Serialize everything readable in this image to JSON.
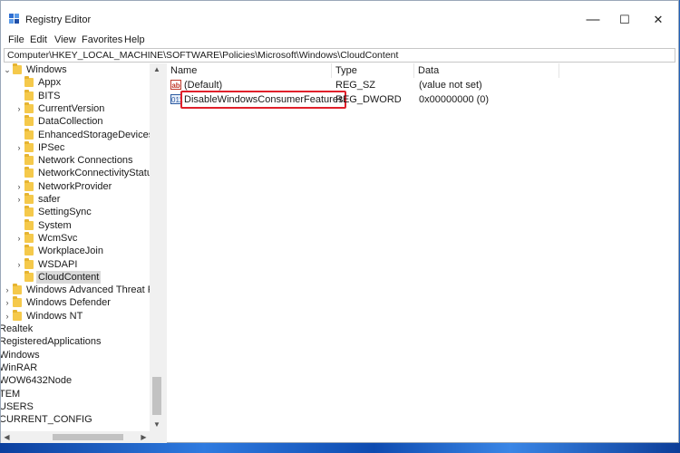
{
  "window": {
    "title": "Registry Editor",
    "icon": "registry-editor-icon",
    "controls": {
      "minimize": "—",
      "maximize": "☐",
      "close": "✕"
    }
  },
  "menu": [
    "File",
    "Edit",
    "View",
    "Favorites",
    "Help"
  ],
  "address": "Computer\\HKEY_LOCAL_MACHINE\\SOFTWARE\\Policies\\Microsoft\\Windows\\CloudContent",
  "tree": {
    "items": [
      {
        "label": "Windows",
        "level": 1,
        "expander": "expanded"
      },
      {
        "label": "Appx",
        "level": 2,
        "expander": "none"
      },
      {
        "label": "BITS",
        "level": 2,
        "expander": "none"
      },
      {
        "label": "CurrentVersion",
        "level": 2,
        "expander": "collapsed"
      },
      {
        "label": "DataCollection",
        "level": 2,
        "expander": "none"
      },
      {
        "label": "EnhancedStorageDevices",
        "level": 2,
        "expander": "none"
      },
      {
        "label": "IPSec",
        "level": 2,
        "expander": "collapsed"
      },
      {
        "label": "Network Connections",
        "level": 2,
        "expander": "none"
      },
      {
        "label": "NetworkConnectivityStatusIn",
        "level": 2,
        "expander": "none"
      },
      {
        "label": "NetworkProvider",
        "level": 2,
        "expander": "collapsed"
      },
      {
        "label": "safer",
        "level": 2,
        "expander": "collapsed"
      },
      {
        "label": "SettingSync",
        "level": 2,
        "expander": "none"
      },
      {
        "label": "System",
        "level": 2,
        "expander": "none"
      },
      {
        "label": "WcmSvc",
        "level": 2,
        "expander": "collapsed"
      },
      {
        "label": "WorkplaceJoin",
        "level": 2,
        "expander": "none"
      },
      {
        "label": "WSDAPI",
        "level": 2,
        "expander": "collapsed"
      },
      {
        "label": "CloudContent",
        "level": 2,
        "expander": "none",
        "selected": true
      },
      {
        "label": "Windows Advanced Threat Prote",
        "level": 1,
        "expander": "collapsed"
      },
      {
        "label": "Windows Defender",
        "level": 1,
        "expander": "collapsed"
      },
      {
        "label": "Windows NT",
        "level": 1,
        "expander": "collapsed"
      },
      {
        "label": "Realtek",
        "level": 0,
        "expander": "none"
      },
      {
        "label": "RegisteredApplications",
        "level": 0,
        "expander": "none"
      },
      {
        "label": "Windows",
        "level": 0,
        "expander": "none"
      },
      {
        "label": "WinRAR",
        "level": 0,
        "expander": "none"
      },
      {
        "label": "WOW6432Node",
        "level": 0,
        "expander": "none"
      },
      {
        "label": "TEM",
        "level": 0,
        "expander": "none"
      },
      {
        "label": "USERS",
        "level": 0,
        "expander": "none"
      },
      {
        "label": "CURRENT_CONFIG",
        "level": 0,
        "expander": "none"
      }
    ]
  },
  "values_pane": {
    "columns": [
      "Name",
      "Type",
      "Data"
    ],
    "rows": [
      {
        "name": "(Default)",
        "type": "REG_SZ",
        "data": "(value not set)",
        "icon": "ab",
        "icon_name": "string-value-icon",
        "highlighted": false
      },
      {
        "name": "DisableWindowsConsumerFeatures",
        "type": "REG_DWORD",
        "data": "0x00000000 (0)",
        "icon": "011",
        "icon_name": "dword-value-icon",
        "highlighted": true
      }
    ]
  },
  "colors": {
    "highlight": "#e0202a",
    "folder": "#f5c94b",
    "selection": "#d9d9d9"
  }
}
